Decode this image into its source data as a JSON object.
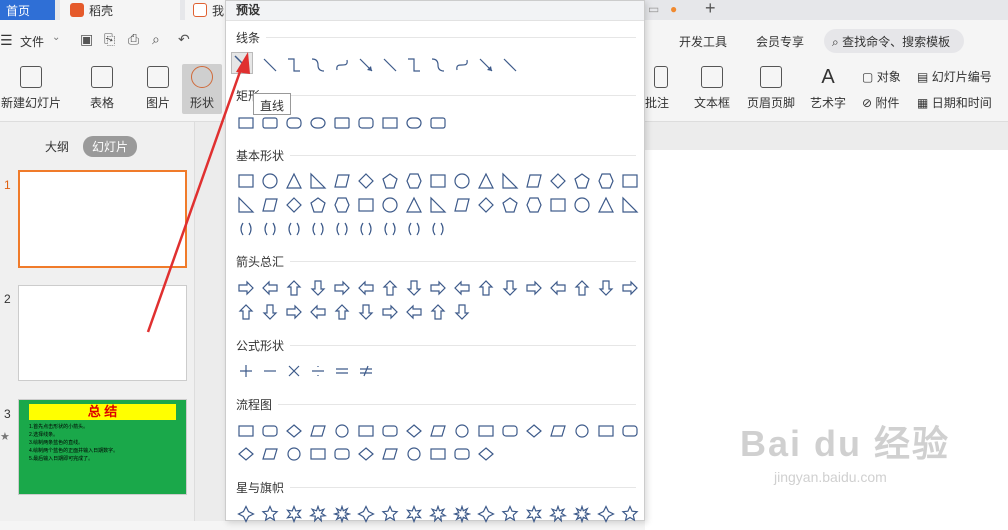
{
  "tabs": {
    "home": "首页",
    "doc": "稻壳",
    "ppt": "我"
  },
  "menu": {
    "dev_tools": "开发工具",
    "member": "会员专享",
    "search": "查找命令、搜索模板",
    "file": "文件"
  },
  "ribbon": {
    "new_slide": "新建幻灯片",
    "table": "表格",
    "picture": "图片",
    "shape": "形状",
    "textbox": "文本框",
    "header_footer": "页眉页脚",
    "wordart": "艺术字",
    "object": "对象",
    "slide_number": "幻灯片编号",
    "attachment": "附件",
    "date_time": "日期和时间",
    "comment": "批注"
  },
  "leftpane": {
    "outline": "大纲",
    "slides": "幻灯片",
    "nums": [
      "1",
      "2",
      "3"
    ],
    "slide3": {
      "title": "总 结",
      "lines": [
        "1.首先点击形状的小箭头。",
        "2.选择线条。",
        "3.绘制两条蓝色的直线。",
        "4.绘制两个蓝色的正面并输入日期数字。",
        "5.最后输入日期即可完成了。"
      ]
    }
  },
  "panel": {
    "title": "预设",
    "sections": [
      "线条",
      "矩形",
      "基本形状",
      "箭头总汇",
      "公式形状",
      "流程图",
      "星与旗帜"
    ],
    "tooltip": "直线"
  },
  "watermark": {
    "brand": "Bai du 经验",
    "url": "jingyan.baidu.com"
  },
  "colors": {
    "accent": "#2f6fd6",
    "shape_stroke": "#3d5a8a",
    "arrow": "#e03030",
    "slide3_bg": "#1aa84a",
    "slide3_title_bg": "#ffff00"
  }
}
